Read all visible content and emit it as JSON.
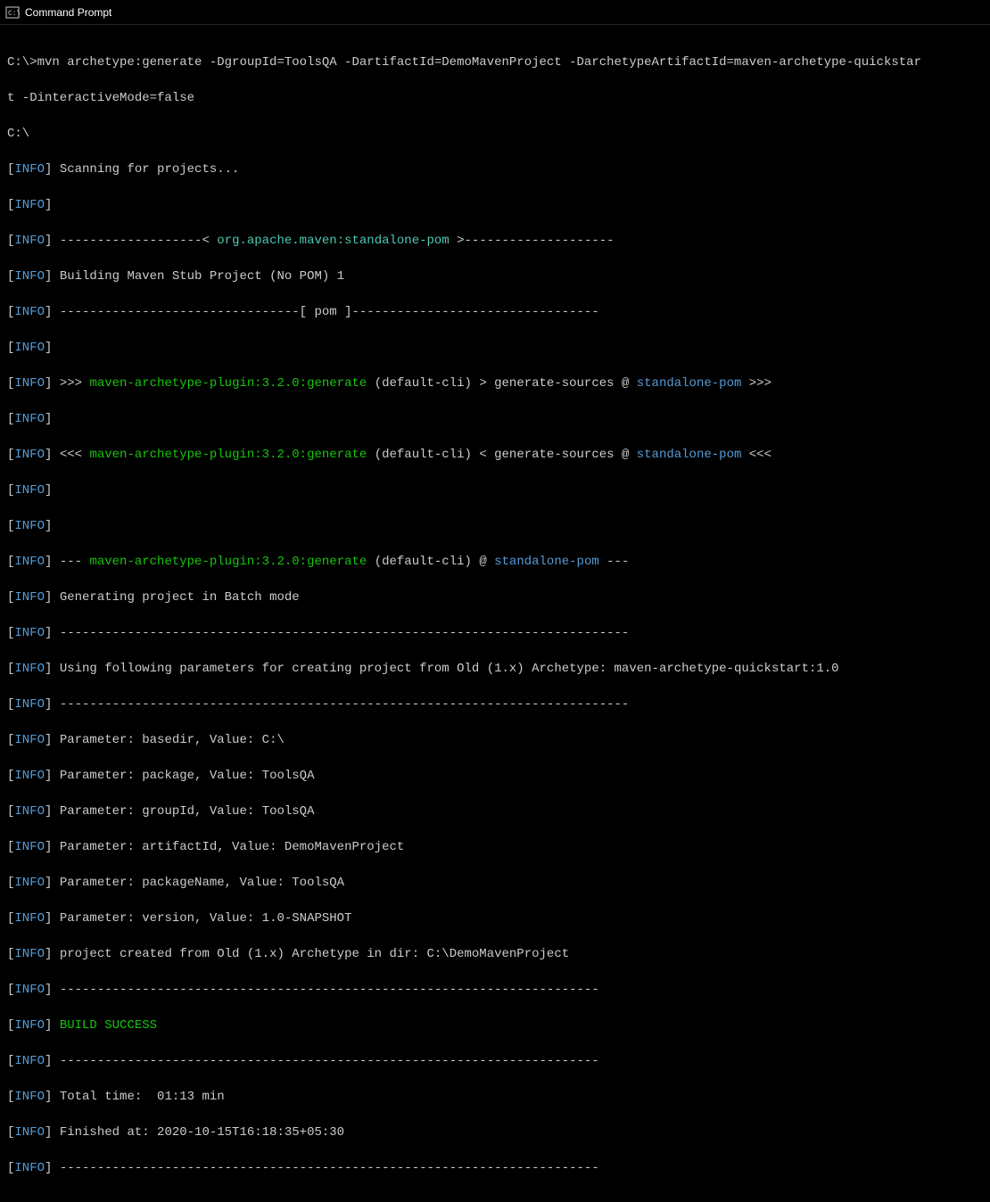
{
  "window": {
    "title": "Command Prompt"
  },
  "prompt": {
    "line1": "C:\\>mvn archetype:generate -DgroupId=ToolsQA -DartifactId=DemoMavenProject -DarchetypeArtifactId=maven-archetype-quickstar",
    "line2": "t -DinteractiveMode=false",
    "line3": "C:\\"
  },
  "labels": {
    "info": "INFO"
  },
  "lines": {
    "scan": "Scanning for projects...",
    "dash_open": "-------------------< ",
    "pom_coords": "org.apache.maven:standalone-pom",
    "dash_close": " >--------------------",
    "building": "Building Maven Stub Project (No POM) 1",
    "pom_rule": "--------------------------------[ pom ]---------------------------------",
    "plugin": "maven-archetype-plugin:3.2.0:generate",
    "gen_default_pre": " (default-cli) > generate-sources @ ",
    "gen_default_post_open": " >>>",
    "standalone": "standalone-pom",
    "gen_default_pre2": " (default-cli) < generate-sources @ ",
    "gen_default_post_close": " <<<",
    "exec_pre": " (default-cli) @ ",
    "exec_post": " ---",
    "triple_right": ">>> ",
    "triple_left": "<<< ",
    "triple_dash": "--- ",
    "batch": "Generating project in Batch mode",
    "long_rule": "----------------------------------------------------------------------------",
    "using": "Using following parameters for creating project from Old (1.x) Archetype: maven-archetype-quickstart:1.0",
    "param_basedir": "Parameter: basedir, Value: C:\\",
    "param_package": "Parameter: package, Value: ToolsQA",
    "param_groupId": "Parameter: groupId, Value: ToolsQA",
    "param_artifactId": "Parameter: artifactId, Value: DemoMavenProject",
    "param_packageName": "Parameter: packageName, Value: ToolsQA",
    "param_version": "Parameter: version, Value: 1.0-SNAPSHOT",
    "created": "project created from Old (1.x) Archetype in dir: C:\\DemoMavenProject",
    "build_rule": "------------------------------------------------------------------------",
    "success": "BUILD SUCCESS",
    "total_time": "Total time:  01:13 min",
    "finished": "Finished at: 2020-10-15T16:18:35+05:30"
  }
}
